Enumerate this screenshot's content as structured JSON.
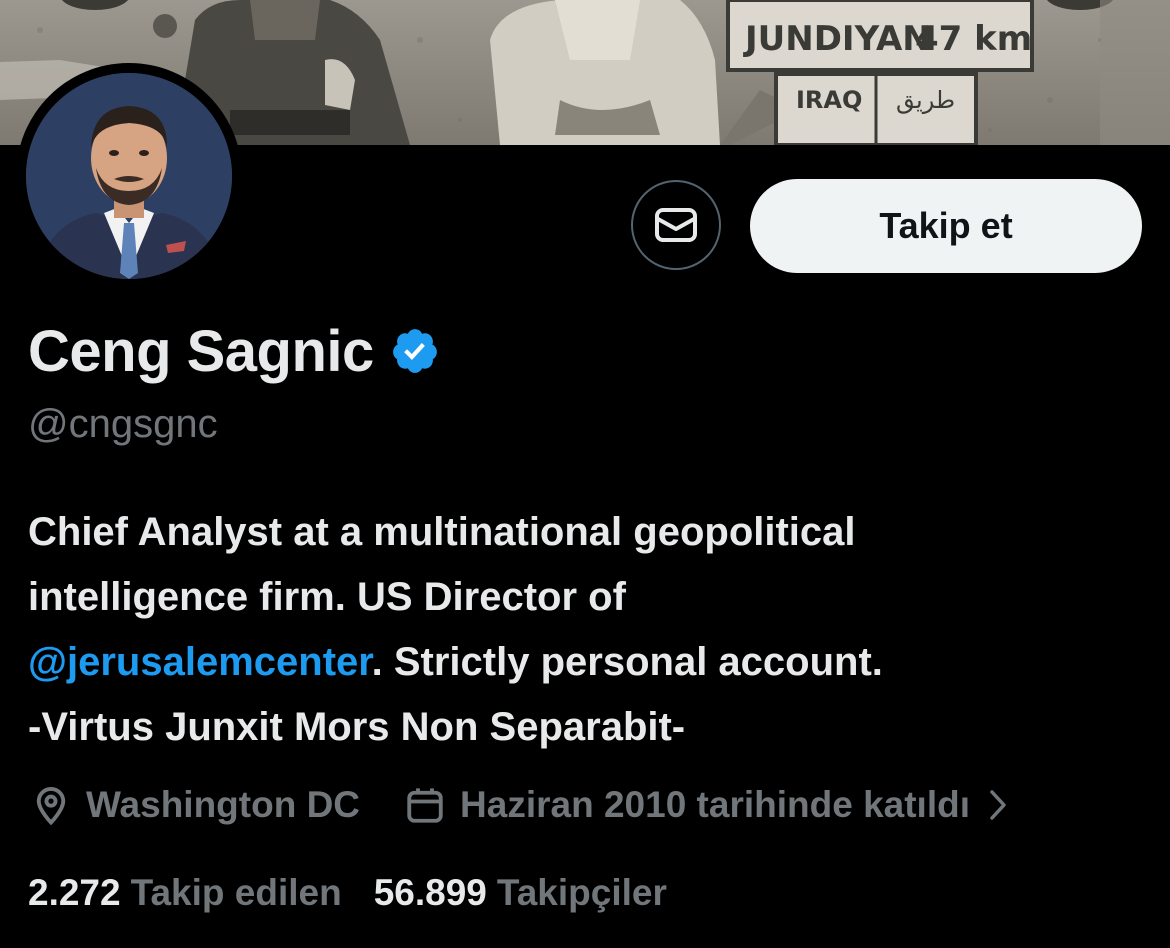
{
  "banner": {
    "sign_top": "JUNDIYAN",
    "sign_distance": "47 km",
    "sign_bottom": "IRAQ",
    "sign_arabic": "طريق"
  },
  "profile": {
    "name": "Ceng Sagnic",
    "handle": "@cngsgnc",
    "verified": true
  },
  "actions": {
    "message_icon": "envelope-icon",
    "follow_label": "Takip et"
  },
  "bio": {
    "line1": "Chief Analyst at a multinational geopolitical",
    "line2": "intelligence firm. US Director of",
    "line3_mention": "@jerusalemcenter",
    "line3_rest": ". Strictly personal account.",
    "line4": "-Virtus Junxit Mors Non Separabit-"
  },
  "meta": {
    "location": "Washington DC",
    "joined": "Haziran 2010 tarihinde katıldı"
  },
  "counts": {
    "following_num": "2.272",
    "following_label": "Takip edilen",
    "followers_num": "56.899",
    "followers_label": "Takipçiler"
  },
  "colors": {
    "background": "#000000",
    "text_primary": "#e7e9ea",
    "text_secondary": "#71767b",
    "accent": "#1d9bf0",
    "follow_button_bg": "#eff3f4"
  }
}
